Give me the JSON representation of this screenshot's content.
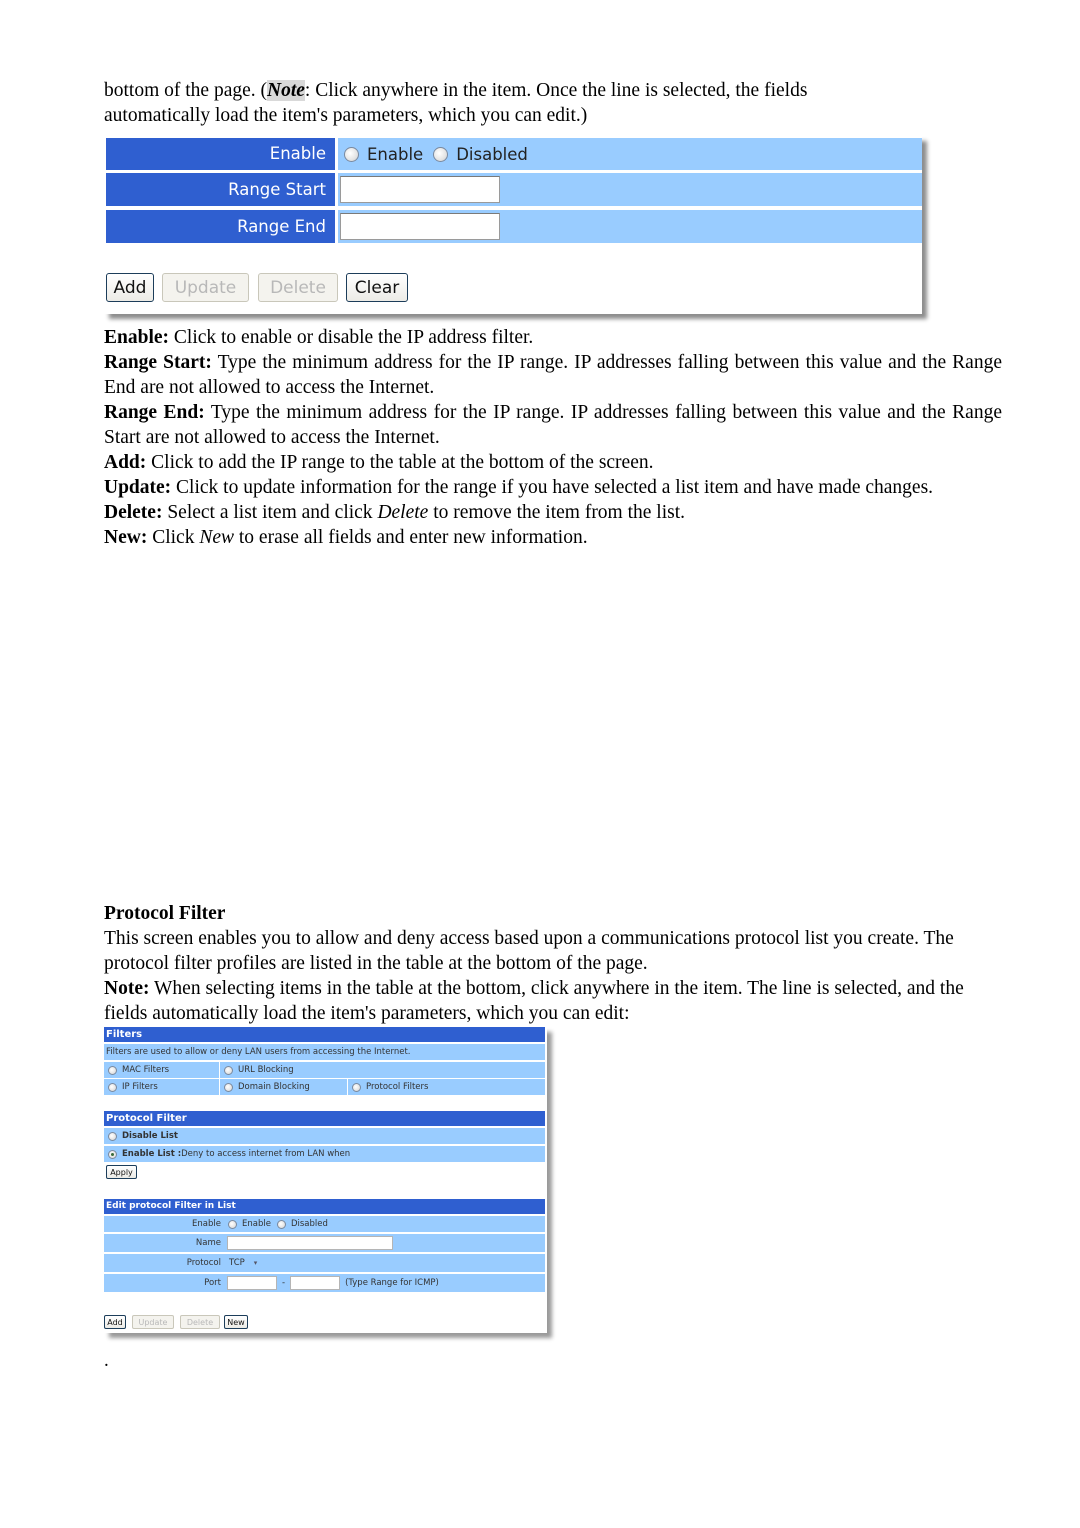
{
  "intro": {
    "line1_before": "bottom of the page. (",
    "note_label": "Note",
    "line1_after": ": Click anywhere in the item. Once the line is selected, the fields",
    "line2": "automatically load the item's parameters, which you can edit.)"
  },
  "ip_filter_form": {
    "rows": [
      {
        "label": "Enable",
        "type": "radio",
        "options": [
          "Enable",
          "Disabled"
        ]
      },
      {
        "label": "Range Start",
        "type": "input",
        "value": ""
      },
      {
        "label": "Range End",
        "type": "input",
        "value": ""
      }
    ],
    "buttons": [
      {
        "label": "Add",
        "enabled": true
      },
      {
        "label": "Update",
        "enabled": false
      },
      {
        "label": "Delete",
        "enabled": false
      },
      {
        "label": "Clear",
        "enabled": true
      }
    ],
    "colors": {
      "label_bg": "#2f5fd0",
      "value_bg": "#99ccff"
    }
  },
  "descriptions": [
    {
      "term": "Enable:",
      "text": " Click to enable or disable the IP address filter."
    },
    {
      "term": "Range Start:",
      "text": " Type the minimum address for the IP range. IP addresses falling between this value and the Range End are not allowed to access the Internet."
    },
    {
      "term": "Range End:",
      "text": " Type the minimum address for the IP range. IP addresses falling between this value and the Range Start are not allowed to access the Internet."
    },
    {
      "term": "Add:",
      "text": " Click to add the IP range to the table at the bottom of the screen."
    },
    {
      "term": "Update:",
      "text": " Click to update information for the range if you have selected a list item and have made changes."
    },
    {
      "term": "Delete:",
      "text_before": " Select a list item and click ",
      "italic": "Delete",
      "text_after": " to remove the item from the list."
    },
    {
      "term": "New:",
      "text_before": " Click ",
      "italic": "New",
      "text_after": " to erase all fields and enter new information."
    }
  ],
  "protocol_section": {
    "heading": "Protocol Filter",
    "para1": "This screen enables you to allow and deny access based upon a communications protocol list you create.  The protocol filter profiles are listed in the table at the bottom of the page.",
    "note_term": "Note:",
    "note_text": " When selecting items in the table at the bottom, click anywhere in the item. The line is selected, and the fields automatically load the item's parameters, which you can edit:"
  },
  "protocol_form": {
    "filters_header": "Filters",
    "filters_desc": "Filters are used to allow or deny LAN users from accessing the Internet.",
    "filter_options": [
      "MAC Filters",
      "URL Blocking",
      "IP Filters",
      "Domain Blocking",
      "Protocol Filters"
    ],
    "protocol_header": "Protocol Filter",
    "disable_list": "Disable List",
    "enable_list": "Enable List :",
    "enable_list_desc": " Deny to access internet from LAN when",
    "enable_list_selected": true,
    "apply_label": "Apply",
    "edit_header": "Edit protocol Filter in List",
    "edit_rows": {
      "enable_label": "Enable",
      "enable_options": [
        "Enable",
        "Disabled"
      ],
      "name_label": "Name",
      "name_value": "",
      "protocol_label": "Protocol",
      "protocol_value": "TCP",
      "port_label": "Port",
      "port_from": "",
      "port_sep": "-",
      "port_to": "",
      "port_hint": "(Type Range for ICMP)"
    },
    "buttons": [
      {
        "label": "Add",
        "enabled": true
      },
      {
        "label": "Update",
        "enabled": false
      },
      {
        "label": "Delete",
        "enabled": false
      },
      {
        "label": "New",
        "enabled": true
      }
    ]
  },
  "trailing_mark": "."
}
